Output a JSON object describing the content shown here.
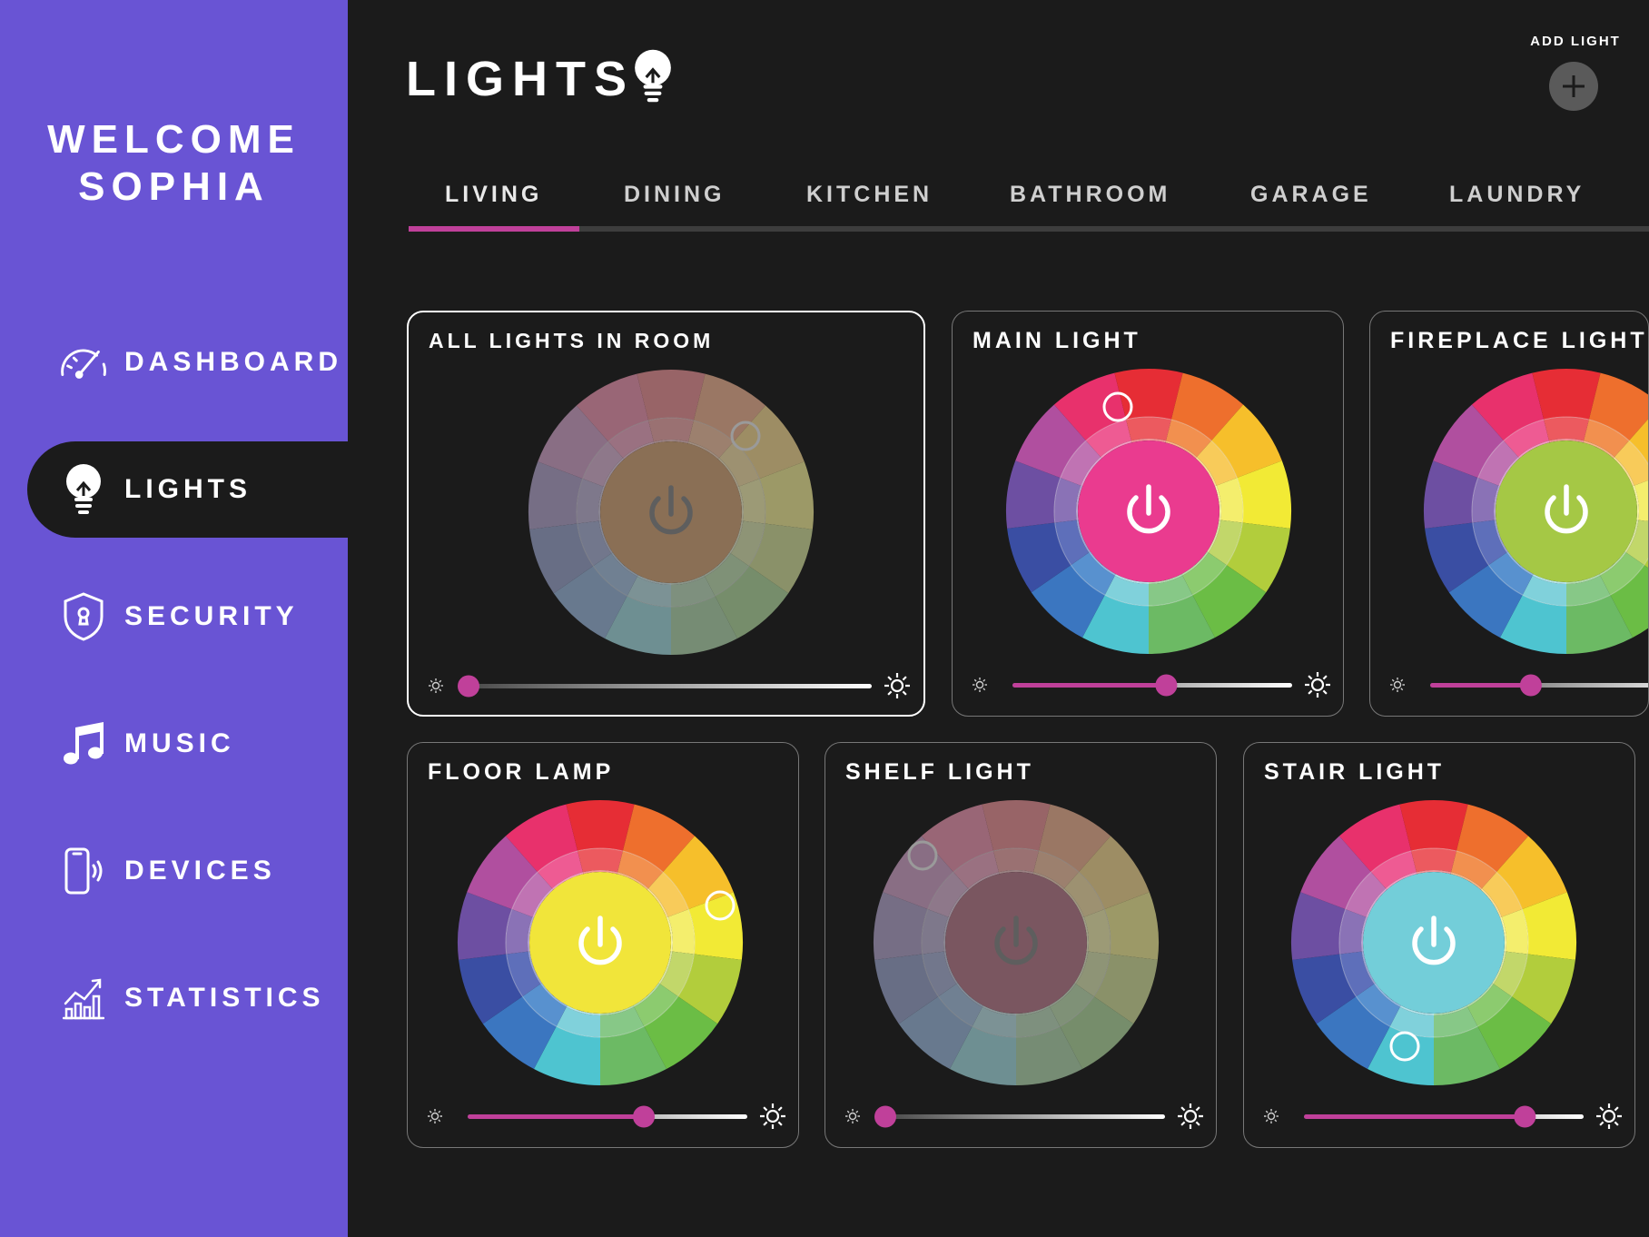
{
  "sidebar": {
    "welcome_line1": "WELCOME",
    "welcome_line2": "SOPHIA",
    "items": [
      {
        "label": "DASHBOARD",
        "icon": "speedometer-icon",
        "active": false
      },
      {
        "label": "LIGHTS",
        "icon": "lightbulb-icon",
        "active": true
      },
      {
        "label": "SECURITY",
        "icon": "shield-lock-icon",
        "active": false
      },
      {
        "label": "MUSIC",
        "icon": "music-note-icon",
        "active": false
      },
      {
        "label": "DEVICES",
        "icon": "phone-vibrate-icon",
        "active": false
      },
      {
        "label": "STATISTICS",
        "icon": "bar-chart-icon",
        "active": false
      }
    ]
  },
  "header": {
    "title": "LIGHTS",
    "title_icon": "lightbulb-icon",
    "add_light_label": "ADD LIGHT",
    "add_icon": "plus-icon"
  },
  "tabs": [
    {
      "label": "LIVING",
      "active": true
    },
    {
      "label": "DINING",
      "active": false
    },
    {
      "label": "KITCHEN",
      "active": false
    },
    {
      "label": "BATHROOM",
      "active": false
    },
    {
      "label": "GARAGE",
      "active": false
    },
    {
      "label": "LAUNDRY",
      "active": false
    }
  ],
  "colors": {
    "sidebar": "#6954d4",
    "background": "#1b1b1b",
    "accent": "#c0409a"
  },
  "lights": [
    {
      "name": "ALL LIGHTS IN ROOM",
      "on": false,
      "selected": true,
      "center_color": "#8a6f55",
      "brightness": 0.0
    },
    {
      "name": "MAIN LIGHT",
      "on": true,
      "selected": false,
      "center_color": "#ea3b8f",
      "brightness": 0.55
    },
    {
      "name": "FIREPLACE LIGHT",
      "on": true,
      "selected": false,
      "center_color": "#a5c845",
      "brightness": 0.36
    },
    {
      "name": "FLOOR LAMP",
      "on": true,
      "selected": false,
      "center_color": "#f1e53a",
      "brightness": 0.63
    },
    {
      "name": "SHELF LIGHT",
      "on": false,
      "selected": false,
      "center_color": "#7a5660",
      "brightness": 0.0
    },
    {
      "name": "STAIR LIGHT",
      "on": true,
      "selected": false,
      "center_color": "#73ced9",
      "brightness": 0.79
    }
  ]
}
